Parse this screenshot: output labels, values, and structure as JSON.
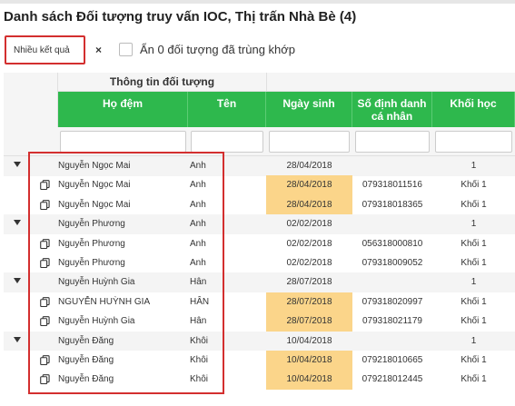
{
  "title": "Danh sách Đối tượng truy vấn IOC, Thị trấn Nhà Bè (4)",
  "filter": {
    "select_value": "Nhiều kết quả",
    "clear_label": "×",
    "hide_label": "Ẩn 0 đối tượng đã trùng khớp"
  },
  "table": {
    "group_header": "Thông tin đối tượng",
    "columns": {
      "ho_dem": "Họ đệm",
      "ten": "Tên",
      "ngay_sinh": "Ngày sinh",
      "so_dinh_danh": "Số định danh cá nhân",
      "khoi_hoc": "Khối học"
    },
    "rows": [
      {
        "type": "parent",
        "ho_dem": "Nguyễn Ngọc Mai",
        "ten": "Anh",
        "ngay_sinh": "28/04/2018",
        "so_dinh_danh": "",
        "khoi_hoc": "1",
        "hl": false
      },
      {
        "type": "child",
        "ho_dem": "Nguyễn Ngọc Mai",
        "ten": "Anh",
        "ngay_sinh": "28/04/2018",
        "so_dinh_danh": "079318011516",
        "khoi_hoc": "Khối 1",
        "hl": true
      },
      {
        "type": "child",
        "ho_dem": "Nguyễn Ngọc Mai",
        "ten": "Anh",
        "ngay_sinh": "28/04/2018",
        "so_dinh_danh": "079318018365",
        "khoi_hoc": "Khối 1",
        "hl": true
      },
      {
        "type": "parent",
        "ho_dem": "Nguyễn Phương",
        "ten": "Anh",
        "ngay_sinh": "02/02/2018",
        "so_dinh_danh": "",
        "khoi_hoc": "1",
        "hl": false
      },
      {
        "type": "child",
        "ho_dem": "Nguyễn Phương",
        "ten": "Anh",
        "ngay_sinh": "02/02/2018",
        "so_dinh_danh": "056318000810",
        "khoi_hoc": "Khối 1",
        "hl": false
      },
      {
        "type": "child",
        "ho_dem": "Nguyễn Phương",
        "ten": "Anh",
        "ngay_sinh": "02/02/2018",
        "so_dinh_danh": "079318009052",
        "khoi_hoc": "Khối 1",
        "hl": false
      },
      {
        "type": "parent",
        "ho_dem": "Nguyễn Huỳnh Gia",
        "ten": "Hân",
        "ngay_sinh": "28/07/2018",
        "so_dinh_danh": "",
        "khoi_hoc": "1",
        "hl": false
      },
      {
        "type": "child",
        "ho_dem": "NGUYỄN HUỲNH GIA",
        "ten": "HÂN",
        "ngay_sinh": "28/07/2018",
        "so_dinh_danh": "079318020997",
        "khoi_hoc": "Khối 1",
        "hl": true
      },
      {
        "type": "child",
        "ho_dem": "Nguyễn Huỳnh Gia",
        "ten": "Hân",
        "ngay_sinh": "28/07/2018",
        "so_dinh_danh": "079318021179",
        "khoi_hoc": "Khối 1",
        "hl": true
      },
      {
        "type": "parent",
        "ho_dem": "Nguyễn Đăng",
        "ten": "Khôi",
        "ngay_sinh": "10/04/2018",
        "so_dinh_danh": "",
        "khoi_hoc": "1",
        "hl": false
      },
      {
        "type": "child",
        "ho_dem": "Nguyễn Đăng",
        "ten": "Khôi",
        "ngay_sinh": "10/04/2018",
        "so_dinh_danh": "079218010665",
        "khoi_hoc": "Khối 1",
        "hl": true
      },
      {
        "type": "child",
        "ho_dem": "Nguyễn Đăng",
        "ten": "Khôi",
        "ngay_sinh": "10/04/2018",
        "so_dinh_danh": "079218012445",
        "khoi_hoc": "Khối 1",
        "hl": true
      }
    ]
  },
  "colors": {
    "header_green": "#2eb84d",
    "highlight": "#fbd58a",
    "annotation_red": "#d32f2f"
  }
}
